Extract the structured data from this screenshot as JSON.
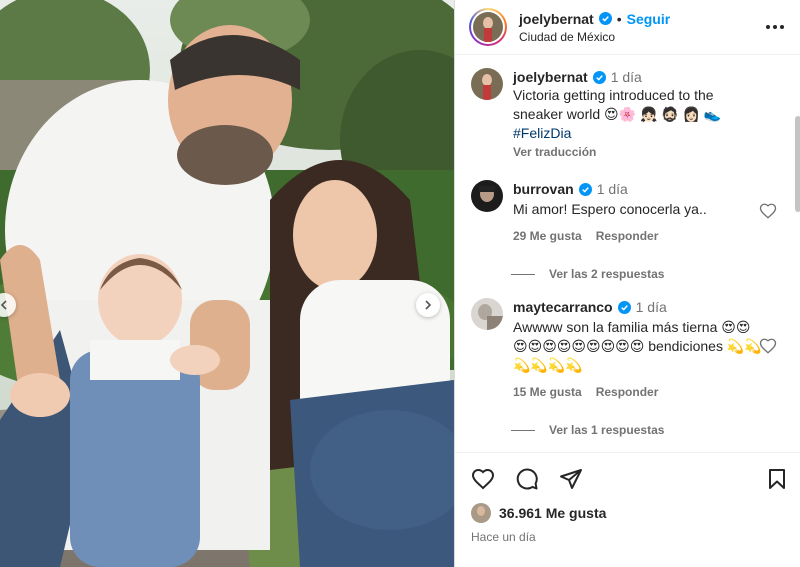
{
  "header": {
    "username": "joelybernat",
    "separator": "•",
    "follow_label": "Seguir",
    "location": "Ciudad de México",
    "more_icon": "more-horizontal-icon"
  },
  "caption": {
    "username": "joelybernat",
    "time": "1 día",
    "text": "Victoria getting introduced to the sneaker world 😍🌸 👧🏻 🧔🏻 👩🏻 👟",
    "hashtag": "#FelizDia",
    "translate_label": "Ver traducción"
  },
  "comments": [
    {
      "username": "burrovan",
      "time": "1 día",
      "text": "Mi amor! Espero conocerla ya..",
      "likes": "29 Me gusta",
      "reply_label": "Responder",
      "view_replies": "Ver las 2 respuestas"
    },
    {
      "username": "maytecarranco",
      "time": "1 día",
      "text": "Awwww son la familia más tierna 😍😍😍😍😍😍😍😍😍😍😍 bendiciones 💫💫💫💫💫💫",
      "likes": "15 Me gusta",
      "reply_label": "Responder",
      "view_replies": "Ver las 1 respuestas"
    }
  ],
  "actions": {
    "like_icon": "heart-icon",
    "comment_icon": "comment-icon",
    "share_icon": "share-icon",
    "save_icon": "bookmark-icon",
    "likes_count": "36.961 Me gusta",
    "posted": "Hace un día"
  },
  "colors": {
    "link_blue": "#0095f6",
    "hashtag": "#00376b",
    "muted": "#737373",
    "text": "#262626"
  }
}
